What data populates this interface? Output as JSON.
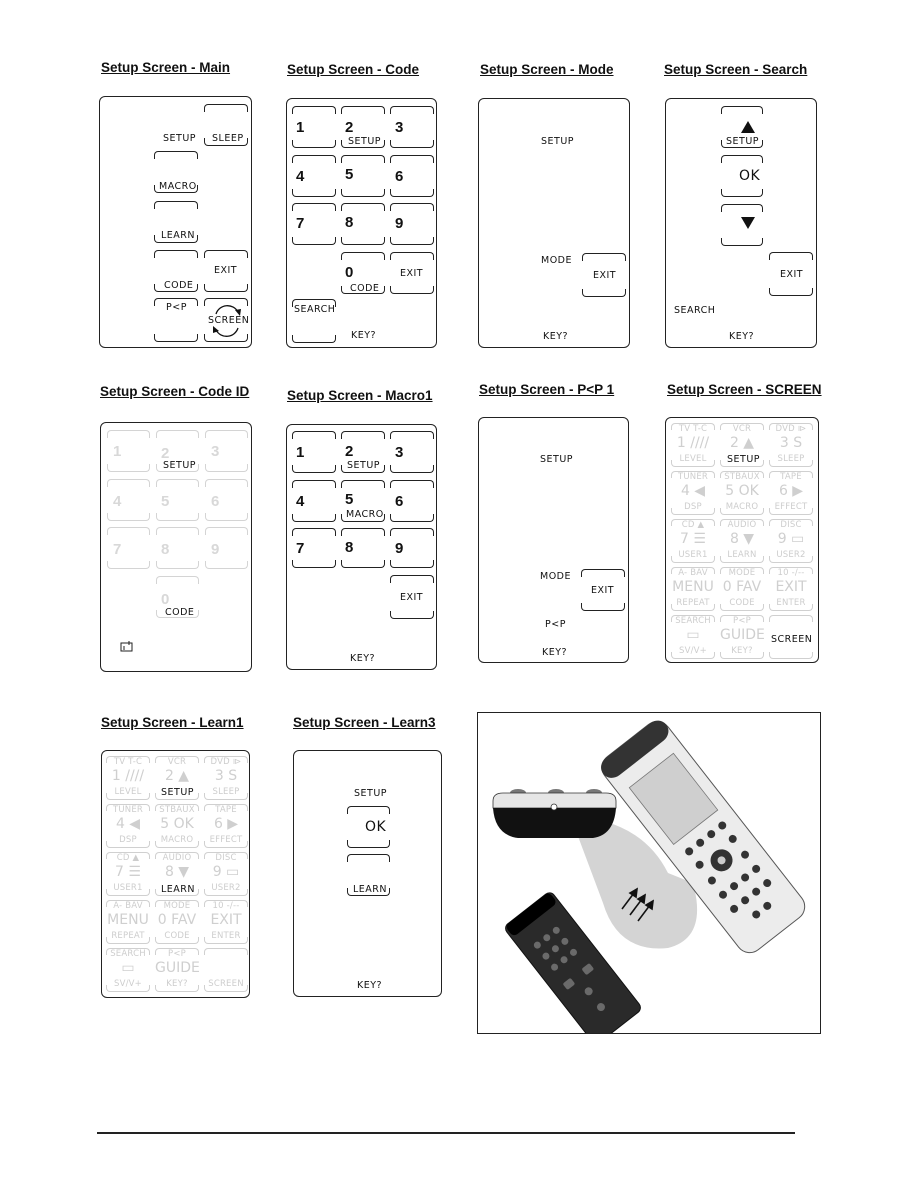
{
  "panels": {
    "main": {
      "title": "Setup Screen - Main",
      "labels": {
        "setup": "SETUP",
        "sleep": "SLEEP",
        "macro": "MACRO",
        "learn": "LEARN",
        "code": "CODE",
        "exit": "EXIT",
        "pp": "P<P",
        "screen": "SCREEN"
      }
    },
    "code": {
      "title": "Setup Screen - Code",
      "digits": [
        "1",
        "2",
        "3",
        "4",
        "5",
        "6",
        "7",
        "8",
        "9",
        "0"
      ],
      "labels": {
        "setup": "SETUP",
        "code": "CODE",
        "exit": "EXIT",
        "search": "SEARCH",
        "key": "KEY?"
      }
    },
    "mode": {
      "title": "Setup Screen - Mode",
      "labels": {
        "setup": "SETUP",
        "mode": "MODE",
        "exit": "EXIT",
        "key": "KEY?"
      }
    },
    "search": {
      "title": "Setup Screen - Search",
      "labels": {
        "setup": "SETUP",
        "ok": "OK",
        "exit": "EXIT",
        "search": "SEARCH",
        "key": "KEY?"
      },
      "icons": {
        "up": "up-triangle-icon",
        "down": "down-triangle-icon"
      }
    },
    "codeid": {
      "title": "Setup Screen - Code ID",
      "digits": [
        "1",
        "2",
        "3",
        "4",
        "5",
        "6",
        "7",
        "8",
        "9",
        "0"
      ],
      "labels": {
        "setup": "SETUP",
        "code": "CODE"
      },
      "icons": {
        "info": "info-card-icon"
      }
    },
    "macro1": {
      "title": "Setup Screen - Macro1",
      "digits": [
        "1",
        "2",
        "3",
        "4",
        "5",
        "6",
        "7",
        "8",
        "9"
      ],
      "labels": {
        "setup": "SETUP",
        "macro": "MACRO",
        "exit": "EXIT",
        "key": "KEY?"
      }
    },
    "pp1": {
      "title": "Setup Screen - P<P 1",
      "labels": {
        "setup": "SETUP",
        "mode": "MODE",
        "exit": "EXIT",
        "pp": "P<P",
        "key": "KEY?"
      }
    },
    "screen": {
      "title": "Setup Screen - SCREEN",
      "highlight": {
        "setup": "SETUP",
        "screen": "SCREEN"
      }
    },
    "learn1": {
      "title": "Setup Screen - Learn1",
      "highlight": {
        "setup": "SETUP",
        "learn": "LEARN"
      }
    },
    "learn3": {
      "title": "Setup Screen - Learn3",
      "labels": {
        "setup": "SETUP",
        "ok": "OK",
        "learn": "LEARN",
        "key": "KEY?"
      }
    }
  },
  "faded_grid": [
    {
      "top": "TV   T-C",
      "mid": "1  ////",
      "bot": "LEVEL"
    },
    {
      "top": "VCR",
      "mid": "2  ▲",
      "bot": "SETUP"
    },
    {
      "top": "DVD ⧐",
      "mid": "3  S",
      "bot": "SLEEP"
    },
    {
      "top": "TUNER",
      "mid": "4  ◀",
      "bot": "DSP"
    },
    {
      "top": "STBAUX",
      "mid": "5 OK",
      "bot": "MACRO"
    },
    {
      "top": "TAPE",
      "mid": "6  ▶",
      "bot": "EFFECT"
    },
    {
      "top": "CD  ▲",
      "mid": "7  ☰",
      "bot": "USER1"
    },
    {
      "top": "AUDIO",
      "mid": "8  ▼",
      "bot": "LEARN"
    },
    {
      "top": "DISC",
      "mid": "9  ▭",
      "bot": "USER2"
    },
    {
      "top": "A- BAV",
      "mid": "MENU",
      "bot": "REPEAT"
    },
    {
      "top": "MODE",
      "mid": "0 FAV",
      "bot": "CODE"
    },
    {
      "top": "10  -/--",
      "mid": "EXIT",
      "bot": "ENTER"
    },
    {
      "top": "SEARCH",
      "mid": "▭",
      "bot": "SV/V+"
    },
    {
      "top": "P<P",
      "mid": "GUIDE",
      "bot": "KEY?"
    },
    {
      "top": "",
      "mid": "",
      "bot": "SCREEN"
    }
  ],
  "figure": {
    "description": "Learning remote illustration: original remote aimed at learning remote IR window",
    "icons": [
      "learning-remote-icon",
      "original-remote-icon",
      "ir-window-closeup-icon",
      "signal-arrows-icon"
    ]
  }
}
